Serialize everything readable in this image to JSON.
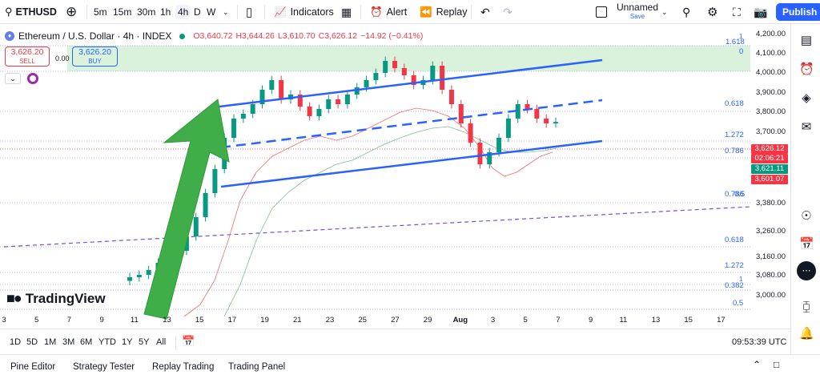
{
  "toolbar": {
    "symbol": "ETHUSD",
    "timeframes": [
      "5m",
      "15m",
      "30m",
      "1h",
      "4h",
      "D",
      "W"
    ],
    "active_timeframe": "4h",
    "indicators_label": "Indicators",
    "alert_label": "Alert",
    "replay_label": "Replay",
    "layout_name": "Unnamed",
    "layout_status": "Save",
    "publish_label": "Publish"
  },
  "legend": {
    "title": "Ethereum / U.S. Dollar · 4h · INDEX",
    "open": "O3,640.72",
    "high": "H3,644.26",
    "low": "L3,610.70",
    "close": "C3,626.12",
    "change": "−14.92 (−0.41%)"
  },
  "trade": {
    "sell_price": "3,626.20",
    "sell_label": "SELL",
    "spread": "0.00",
    "buy_price": "3,626.20",
    "buy_label": "BUY"
  },
  "price_axis": [
    {
      "label": "4,200.00",
      "value": 4200
    },
    {
      "label": "4,100.00",
      "value": 4100
    },
    {
      "label": "4,000.00",
      "value": 4000
    },
    {
      "label": "3,900.00",
      "value": 3900
    },
    {
      "label": "3,800.00",
      "value": 3800
    },
    {
      "label": "3,700.00",
      "value": 3700
    },
    {
      "label": "3,380.00",
      "value": 3380
    },
    {
      "label": "3,260.00",
      "value": 3260
    },
    {
      "label": "3,160.00",
      "value": 3160
    },
    {
      "label": "3,080.00",
      "value": 3080
    },
    {
      "label": "3,000.00",
      "value": 3000
    }
  ],
  "price_labels": {
    "last": "3,626.12",
    "countdown": "02:06:21",
    "green": "3,621.11",
    "red": "3,601.07"
  },
  "fib_labels_upper": [
    "1.618",
    "1",
    "0",
    "0.618",
    "1.272",
    "0.786",
    "0.786",
    "0.5"
  ],
  "fib_labels_lower": [
    "0.618",
    "1.272",
    "1",
    "0.382",
    "0.5"
  ],
  "x_axis": [
    "3",
    "5",
    "7",
    "9",
    "11",
    "13",
    "15",
    "17",
    "19",
    "21",
    "23",
    "25",
    "27",
    "29",
    "Aug",
    "3",
    "5",
    "7",
    "9",
    "11",
    "13",
    "15",
    "17"
  ],
  "logo_text": "TradingView",
  "ranges": [
    "1D",
    "5D",
    "1M",
    "3M",
    "6M",
    "YTD",
    "1Y",
    "5Y",
    "All"
  ],
  "clock": "09:53:39 UTC",
  "bottom_tabs": [
    "Pine Editor",
    "Strategy Tester",
    "Replay Trading",
    "Trading Panel"
  ],
  "colors": {
    "up": "#089981",
    "down": "#f23645",
    "channel": "#2962ff",
    "arrow": "#3fae49",
    "zone": "#d4efd6"
  },
  "chart_data": {
    "type": "candlestick",
    "ylim": [
      3000,
      4200
    ],
    "close_series": [
      2980,
      2990,
      3010,
      3040,
      3060,
      3090,
      3150,
      3230,
      3330,
      3430,
      3560,
      3640,
      3660,
      3700,
      3760,
      3800,
      3720,
      3740,
      3690,
      3650,
      3680,
      3720,
      3700,
      3740,
      3770,
      3800,
      3830,
      3880,
      3850,
      3820,
      3780,
      3800,
      3860,
      3760,
      3700,
      3620,
      3540,
      3450,
      3500,
      3560,
      3640,
      3700,
      3680,
      3640,
      3620,
      3626
    ]
  }
}
